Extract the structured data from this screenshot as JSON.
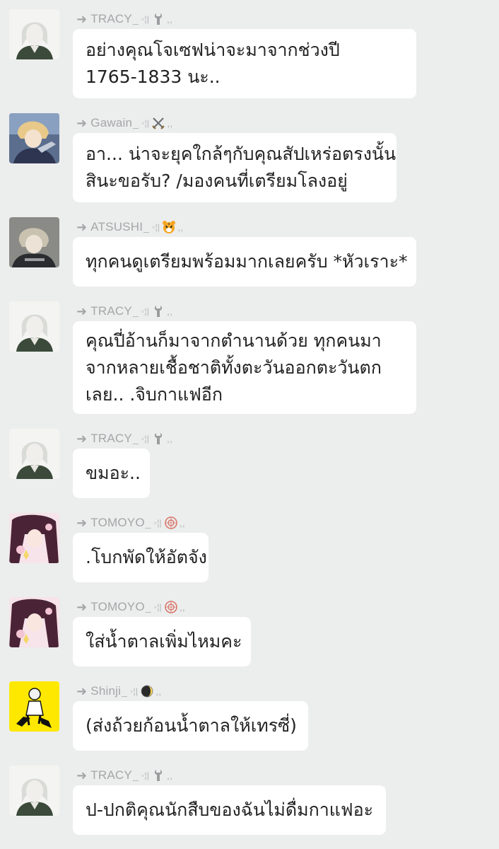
{
  "messages": [
    {
      "sender": "TRACY",
      "avatar": "tracy-avatar",
      "badge": "wrench-icon",
      "lines": [
        "อย่างคุณโจเซฟน่าจะมาจากช่วงปี",
        "1765-1833 นะ.."
      ]
    },
    {
      "sender": "Gawain",
      "avatar": "gawain-avatar",
      "badge": "crossed-swords-icon",
      "lines": [
        "อา... น่าจะยุคใกล้ๆกับคุณสัปเหร่อตรงนั้น",
        "สินะขอรับ? /มองคนที่เตรียมโลงอยู่"
      ]
    },
    {
      "sender": "ATSUSHI",
      "avatar": "atsushi-avatar",
      "badge": "tiger-face-icon",
      "lines": [
        "ทุกคนดูเตรียมพร้อมมากเลยครับ *หัวเราะ*"
      ]
    },
    {
      "sender": "TRACY",
      "avatar": "tracy-avatar",
      "badge": "wrench-icon",
      "lines": [
        "คุณปี่อ้านก็มาจากตำนานด้วย ทุกคนมา",
        "จากหลายเชื้อชาติทั้งตะวันออกตะวันตก",
        "เลย.. .จิบกาแฟอีก"
      ]
    },
    {
      "sender": "TRACY",
      "avatar": "tracy-avatar",
      "badge": "wrench-icon",
      "lines": [
        "ขมอะ.."
      ]
    },
    {
      "sender": "TOMOYO",
      "avatar": "tomoyo-avatar",
      "badge": "seal-flower-icon",
      "lines": [
        ".โบกพัดให้อัตจัง"
      ]
    },
    {
      "sender": "TOMOYO",
      "avatar": "tomoyo-avatar",
      "badge": "seal-flower-icon",
      "lines": [
        "ใส่น้ำตาลเพิ่มไหมคะ"
      ]
    },
    {
      "sender": "Shinji",
      "avatar": "shinji-avatar",
      "badge": "moon-icon",
      "lines": [
        "(ส่งถ้วยก้อนน้ำตาลให้เทรซี่)"
      ]
    },
    {
      "sender": "TRACY",
      "avatar": "tracy-avatar",
      "badge": "wrench-icon",
      "lines": [
        "ป-ปกติคุณนักสืบของฉันไม่ดื่มกาแฟอะ"
      ]
    }
  ]
}
